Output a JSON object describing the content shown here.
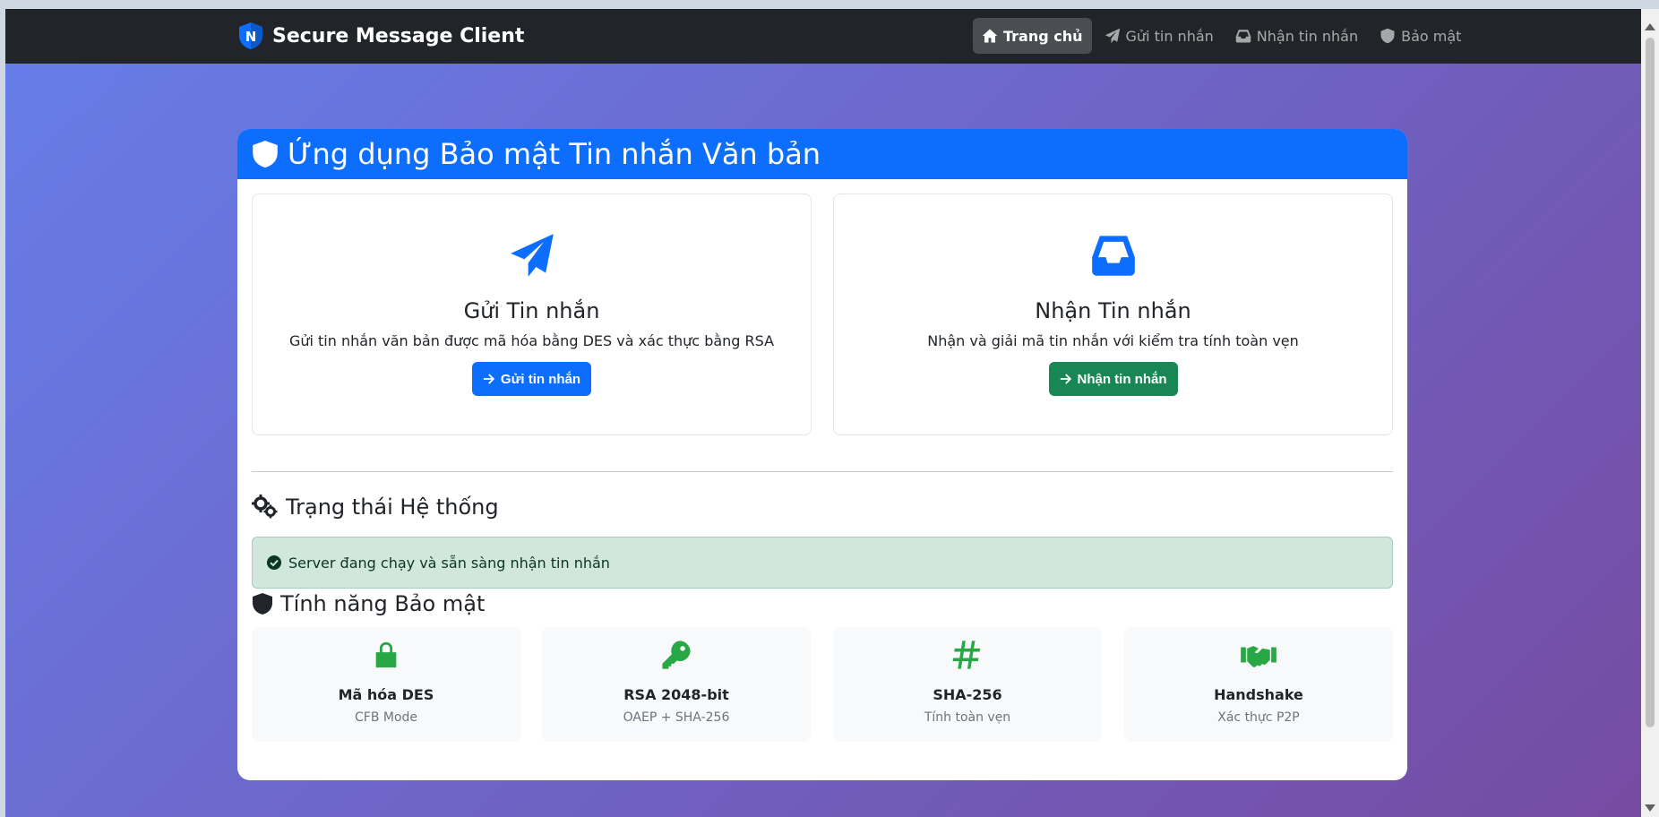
{
  "navbar": {
    "brand_text": "Secure Message Client",
    "brand_logo_letter": "N",
    "links": [
      {
        "label": "Trang chủ",
        "icon": "home-icon",
        "active": true
      },
      {
        "label": "Gửi tin nhắn",
        "icon": "paper-plane-icon"
      },
      {
        "label": "Nhận tin nhắn",
        "icon": "inbox-icon"
      },
      {
        "label": "Bảo mật",
        "icon": "shield-icon"
      }
    ]
  },
  "main": {
    "title": "Ứng dụng Bảo mật Tin nhắn Văn bản",
    "send_card": {
      "title": "Gửi Tin nhắn",
      "description": "Gửi tin nhắn văn bản được mã hóa bằng DES và xác thực bằng RSA",
      "button_label": "Gửi tin nhắn"
    },
    "receive_card": {
      "title": "Nhận Tin nhắn",
      "description": "Nhận và giải mã tin nhắn với kiểm tra tính toàn vẹn",
      "button_label": "Nhận tin nhắn"
    },
    "status_section": {
      "title": "Trạng thái Hệ thống",
      "message": "Server đang chạy và sẵn sàng nhận tin nhắn"
    },
    "security_section": {
      "title": "Tính năng Bảo mật",
      "features": [
        {
          "name": "Mã hóa DES",
          "description": "CFB Mode",
          "icon": "lock-icon"
        },
        {
          "name": "RSA 2048-bit",
          "description": "OAEP + SHA-256",
          "icon": "key-icon"
        },
        {
          "name": "SHA-256",
          "description": "Tính toàn vẹn",
          "icon": "hashtag-icon"
        },
        {
          "name": "Handshake",
          "description": "Xác thực P2P",
          "icon": "handshake-icon"
        }
      ]
    }
  },
  "colors": {
    "primary": "#0d6efd",
    "success": "#198754",
    "feature_icon": "#28a745",
    "navbar": "#212529",
    "gradient_start": "#667eea",
    "gradient_end": "#764ba2"
  }
}
